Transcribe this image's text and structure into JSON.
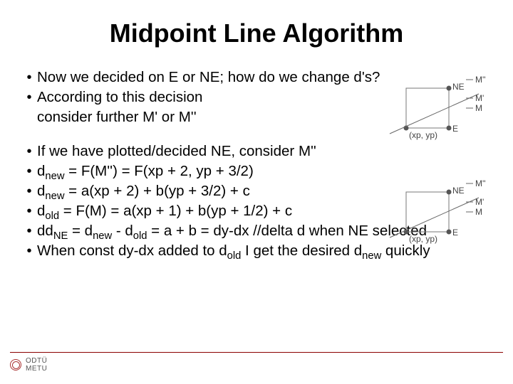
{
  "title": "Midpoint Line Algorithm",
  "intro": {
    "line1": "Now we decided on E or NE; how do we change d's?",
    "line2": "According to this decision",
    "line3": "consider further M' or M''"
  },
  "items": {
    "b1": "If we have plotted/decided NE, consider M''",
    "b2_pre": "d",
    "b2_sub1": "new",
    "b2_mid": " = F(M'') = F(xp + 2, yp + 3/2)",
    "b3_pre": "d",
    "b3_sub1": "new",
    "b3_mid": " = a(xp + 2) + b(yp + 3/2) + c",
    "b4_pre": "d",
    "b4_sub1": "old",
    "b4_mid": " = F(M) = a(xp + 1) + b(yp + 1/2) + c",
    "b5_pre": "dd",
    "b5_sub1": "NE",
    "b5_m1": " = d",
    "b5_sub2": "new",
    "b5_m2": " - d",
    "b5_sub3": "old",
    "b5_m3": " = a + b = dy-dx //delta d when NE selected",
    "b6_p1": "When const dy-dx added to d",
    "b6_sub1": "old",
    "b6_p2": " I get the desired d",
    "b6_sub2": "new",
    "b6_p3": " quickly"
  },
  "diagram": {
    "NE": "NE",
    "E": "E",
    "Mpp": "M''",
    "Mp": "M'",
    "M": "M",
    "pt": "(xp, yp)"
  },
  "footer": {
    "logo_top": "ODTÜ",
    "logo_bot": "METU"
  }
}
